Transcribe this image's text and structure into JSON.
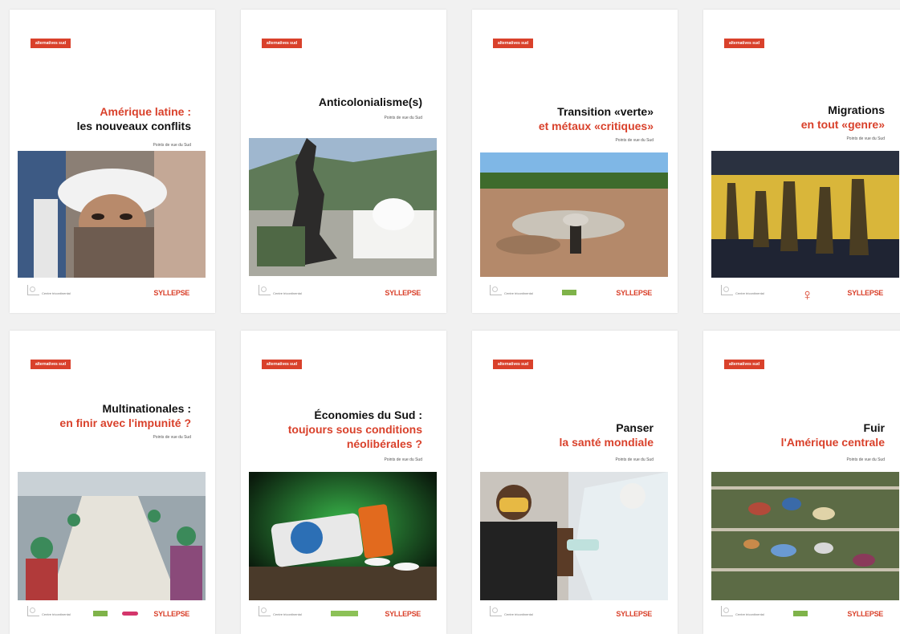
{
  "colors": {
    "accent": "#d9412b",
    "text": "#111111",
    "background": "#f1f1f1"
  },
  "icons": {
    "partner_logo": "triangle-logo",
    "publisher_logo": "syllepse-logo",
    "female_symbol": "♀"
  },
  "common": {
    "badge": "alternatives sud",
    "subtitle": "Points de vue du Sud",
    "partner_logo_text": "Centre tricontinental",
    "publisher_logo_text": "SYLLEPSE"
  },
  "covers": [
    {
      "title_line1": "Amérique latine :",
      "title_line2": "les nouveaux conflits"
    },
    {
      "title_line1": "Anticolonialisme(s)",
      "title_line2": ""
    },
    {
      "title_line1": "Transition «verte»",
      "title_line2": "et métaux «critiques»"
    },
    {
      "title_line1": "Migrations",
      "title_line2": "en tout «genre»"
    },
    {
      "title_line1": "Multinationales :",
      "title_line2": "en finir avec l'impunité ?"
    },
    {
      "title_line1": "Économies du Sud :",
      "title_line2": "toujours sous conditions",
      "title_line3": "néolibérales ?"
    },
    {
      "title_line1": "Panser",
      "title_line2": "la santé mondiale"
    },
    {
      "title_line1": "Fuir",
      "title_line2": "l'Amérique centrale"
    }
  ]
}
